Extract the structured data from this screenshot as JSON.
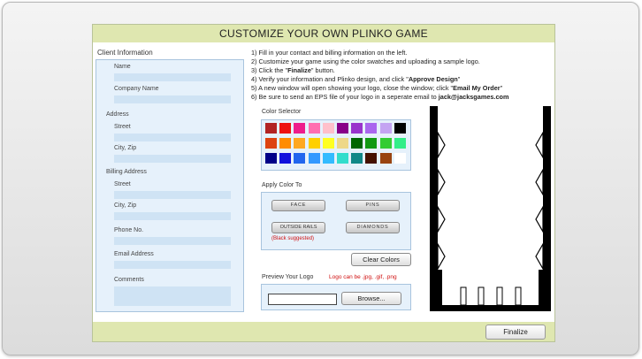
{
  "header": {
    "title": "CUSTOMIZE YOUR OWN PLINKO GAME"
  },
  "client": {
    "title": "Client Information",
    "name_label": "Name",
    "company_label": "Company Name",
    "address_label": "Address",
    "street_label": "Street",
    "city_label": "City, Zip",
    "billing_label": "Billing Address",
    "billing_street_label": "Street",
    "billing_city_label": "City, Zip",
    "phone_label": "Phone No.",
    "email_label": "Email Address",
    "comments_label": "Comments"
  },
  "instructions": {
    "line1": "1) Fill in your contact and billing information on the left.",
    "line2": "2) Customize your game using the color swatches and uploading a sample logo.",
    "line3_pre": "3) Click the \"",
    "line3_bold": "Finalize",
    "line3_post": "\" button.",
    "line4_pre": "4) Verify your information and Plinko design, and click \"",
    "line4_bold": "Approve Design",
    "line4_post": "\"",
    "line5_pre": "5) A new window will open showing your logo, close the window; click \"",
    "line5_bold": "Email My Order",
    "line5_post": "\"",
    "line6_pre": "6) Be sure to send an EPS file of your logo in a seperate email to ",
    "line6_bold": "jack@jacksgames.com"
  },
  "color_selector": {
    "title": "Color Selector",
    "swatches": [
      [
        "#b22323",
        "#ee1111",
        "#ee1c8c",
        "#ff6eb0",
        "#ffc0cb",
        "#880088",
        "#9933cc",
        "#aa66ee",
        "#c4a4f2",
        "#000000"
      ],
      [
        "#dd4411",
        "#ff8c00",
        "#ffa820",
        "#ffd000",
        "#ffff22",
        "#eed888",
        "#006600",
        "#119911",
        "#33cc33",
        "#33ee88"
      ],
      [
        "#000088",
        "#1111dd",
        "#2266ee",
        "#3399ff",
        "#33bbff",
        "#33ddcc",
        "#118888",
        "#441100",
        "#994411",
        "#ffffff"
      ]
    ]
  },
  "apply": {
    "title": "Apply Color To",
    "face": "FACE",
    "pins": "PINS",
    "outside_rails": "OUTSIDE RAILS",
    "diamonds": "DIAMONDS",
    "black_note": "(Black suggested)"
  },
  "clear_label": "Clear Colors",
  "preview": {
    "title": "Preview Your Logo",
    "note": "Logo can be .jpg, .gif, .png",
    "browse_label": "Browse..."
  },
  "footer": {
    "finalize_label": "Finalize"
  }
}
